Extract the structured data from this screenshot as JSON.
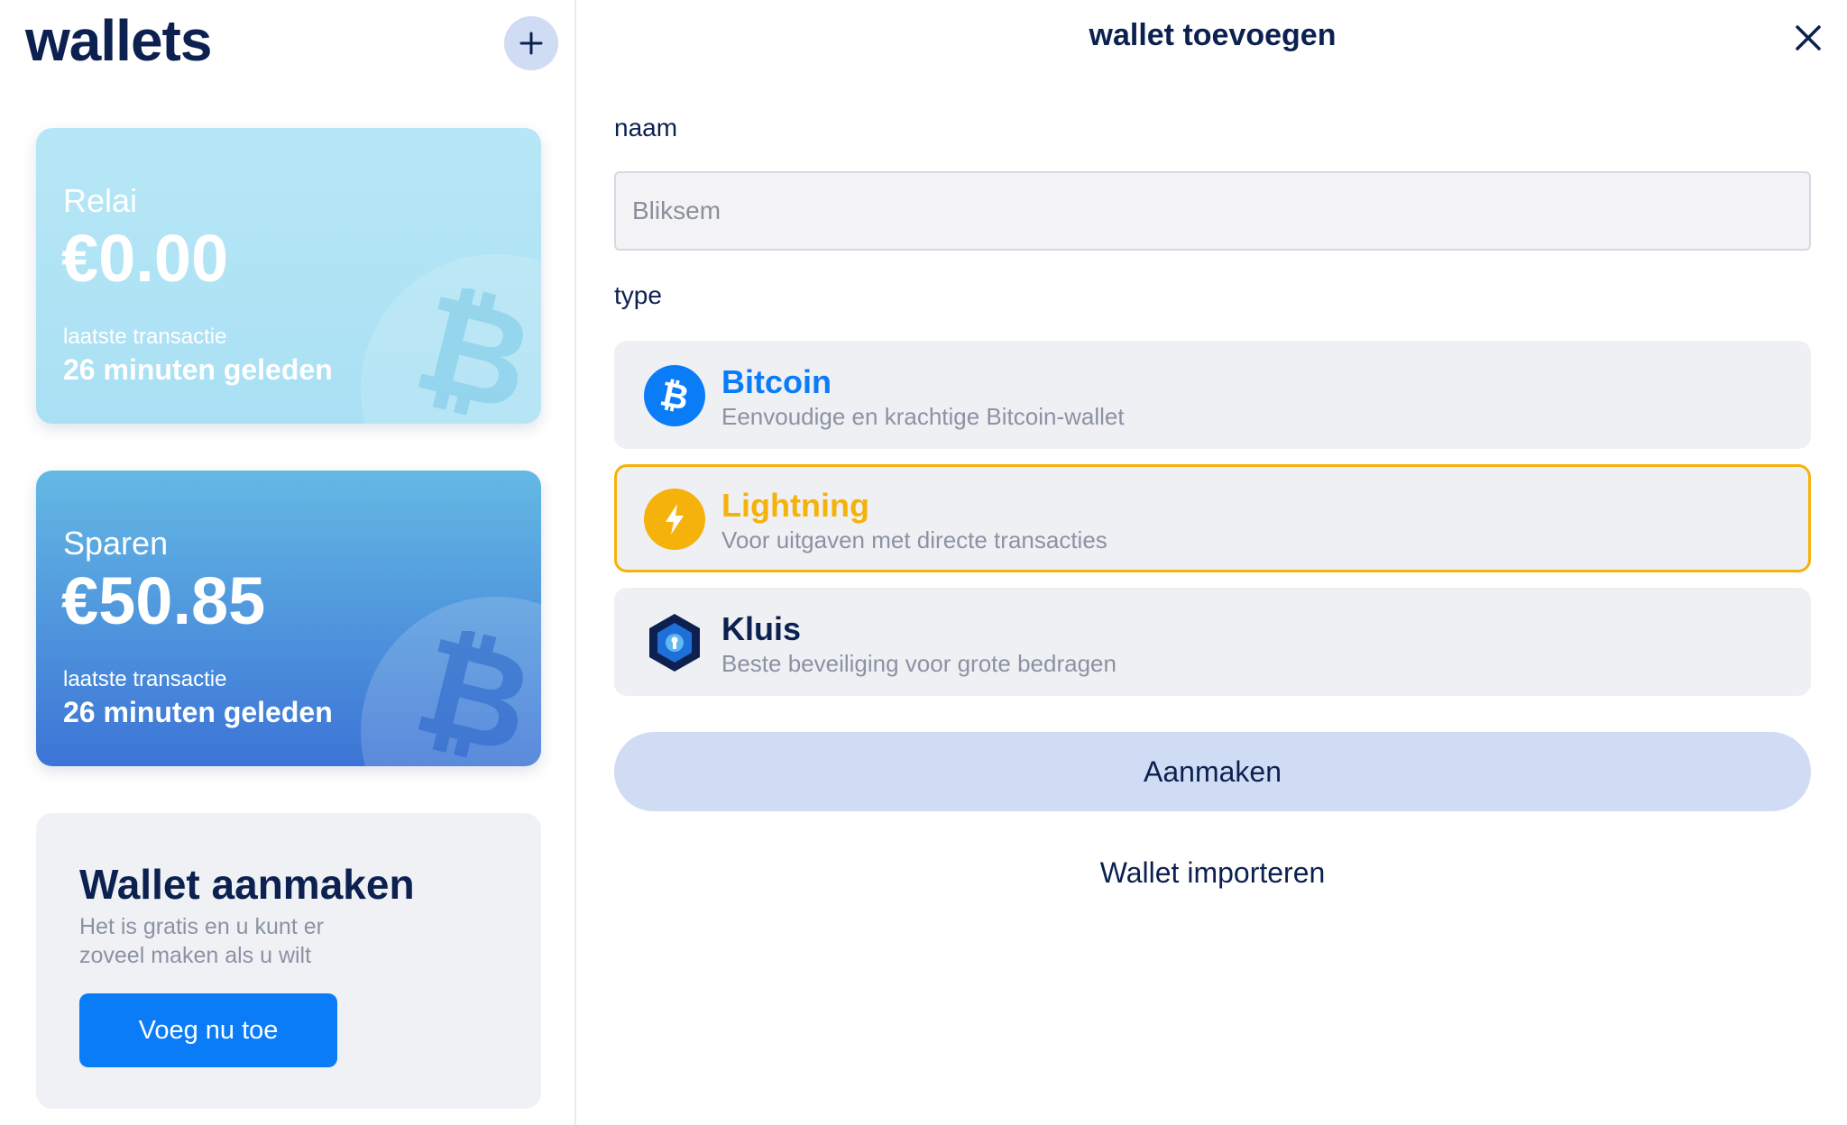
{
  "sidebar": {
    "title": "wallets",
    "add_icon": "plus-icon",
    "wallets": [
      {
        "name": "Relai",
        "balance": "€0.00",
        "last_label": "laatste transactie",
        "last_time": "26 minuten geleden"
      },
      {
        "name": "Sparen",
        "balance": "€50.85",
        "last_label": "laatste transactie",
        "last_time": "26 minuten geleden"
      }
    ],
    "create_card": {
      "title": "Wallet aanmaken",
      "description": "Het is gratis en u kunt er zoveel maken als u wilt",
      "button_label": "Voeg nu toe"
    }
  },
  "panel": {
    "title": "wallet toevoegen",
    "close_icon": "close-icon",
    "name_label": "naam",
    "name_value": "",
    "name_placeholder": "Bliksem",
    "type_label": "type",
    "types": [
      {
        "name": "Bitcoin",
        "description": "Eenvoudige en krachtige Bitcoin-wallet",
        "icon": "bitcoin-icon",
        "color": "#0a7cf8",
        "selected": false
      },
      {
        "name": "Lightning",
        "description": "Voor uitgaven met directe transacties",
        "icon": "lightning-icon",
        "color": "#f5b20b",
        "selected": true
      },
      {
        "name": "Kluis",
        "description": "Beste beveiliging voor grote bedragen",
        "icon": "vault-icon",
        "color": "#0c2150",
        "selected": false
      }
    ],
    "submit_label": "Aanmaken",
    "import_label": "Wallet importeren"
  },
  "colors": {
    "primary": "#0a7cf8",
    "lightning": "#f5b20b",
    "navy": "#0c2150",
    "soft_blue": "#cfdcf3"
  }
}
